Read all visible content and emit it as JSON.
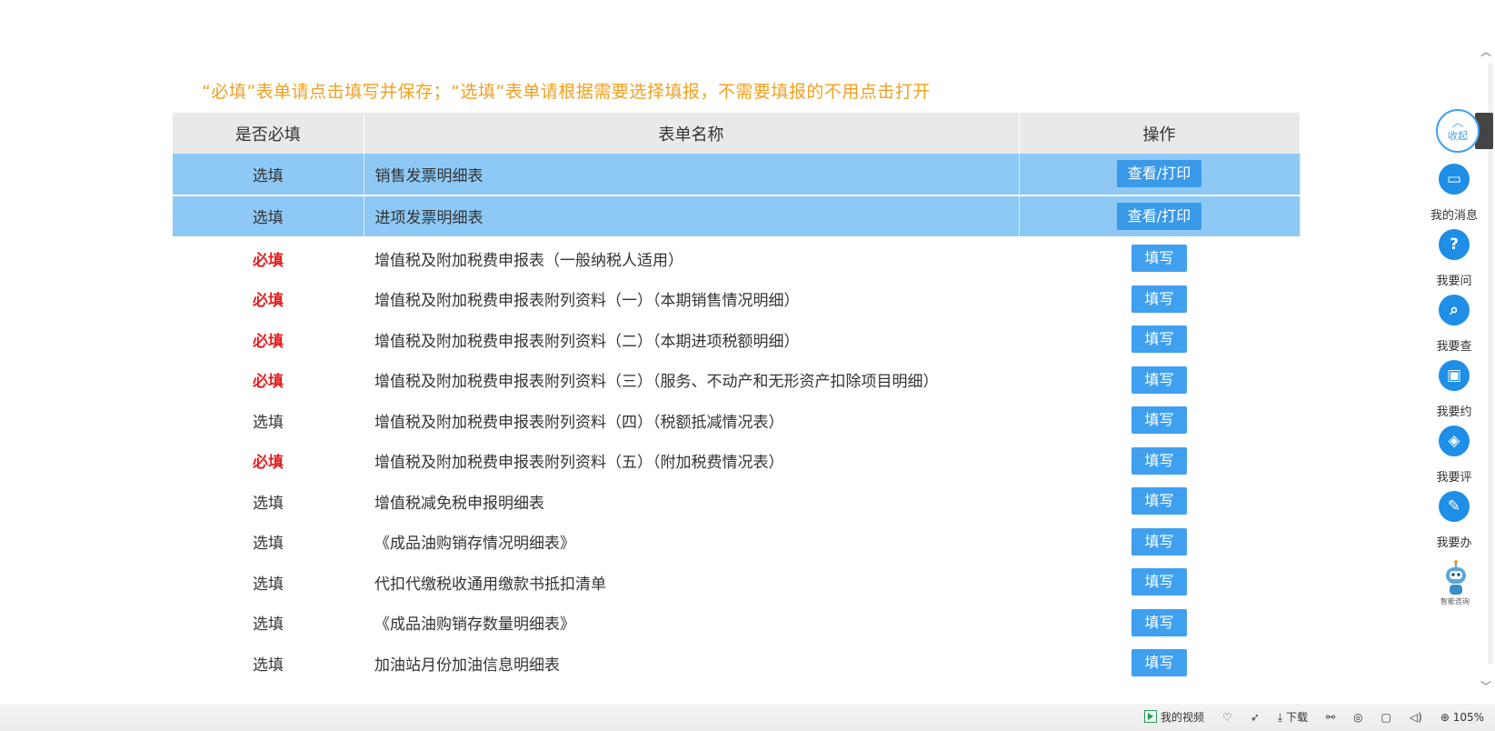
{
  "notice": "“必填”表单请点击填写并保存；“选填”表单请根据需要选择填报，不需要填报的不用点击打开",
  "table": {
    "headers": [
      "是否必填",
      "表单名称",
      "操作"
    ],
    "rows": [
      {
        "req": "选填",
        "name": "销售发票明细表",
        "op": "查看/打印",
        "highlight": true,
        "required": false
      },
      {
        "req": "选填",
        "name": "进项发票明细表",
        "op": "查看/打印",
        "highlight": true,
        "required": false
      },
      {
        "req": "必填",
        "name": "增值税及附加税费申报表（一般纳税人适用）",
        "op": "填写",
        "highlight": false,
        "required": true
      },
      {
        "req": "必填",
        "name": "增值税及附加税费申报表附列资料（一）（本期销售情况明细）",
        "op": "填写",
        "highlight": false,
        "required": true
      },
      {
        "req": "必填",
        "name": "增值税及附加税费申报表附列资料（二）（本期进项税额明细）",
        "op": "填写",
        "highlight": false,
        "required": true
      },
      {
        "req": "必填",
        "name": "增值税及附加税费申报表附列资料（三）（服务、不动产和无形资产扣除项目明细）",
        "op": "填写",
        "highlight": false,
        "required": true
      },
      {
        "req": "选填",
        "name": "增值税及附加税费申报表附列资料（四）（税额抵减情况表）",
        "op": "填写",
        "highlight": false,
        "required": false
      },
      {
        "req": "必填",
        "name": "增值税及附加税费申报表附列资料（五）（附加税费情况表）",
        "op": "填写",
        "highlight": false,
        "required": true
      },
      {
        "req": "选填",
        "name": "增值税减免税申报明细表",
        "op": "填写",
        "highlight": false,
        "required": false
      },
      {
        "req": "选填",
        "name": "《成品油购销存情况明细表》",
        "op": "填写",
        "highlight": false,
        "required": false
      },
      {
        "req": "选填",
        "name": "代扣代缴税收通用缴款书抵扣清单",
        "op": "填写",
        "highlight": false,
        "required": false
      },
      {
        "req": "选填",
        "name": "《成品油购销存数量明细表》",
        "op": "填写",
        "highlight": false,
        "required": false
      },
      {
        "req": "选填",
        "name": "加油站月份加油信息明细表",
        "op": "填写",
        "highlight": false,
        "required": false
      }
    ]
  },
  "side_panel": {
    "collapse": "收起",
    "items": [
      {
        "label": "我的消息",
        "icon": "message-icon"
      },
      {
        "label": "我要问",
        "icon": "question-icon"
      },
      {
        "label": "我要查",
        "icon": "search-icon"
      },
      {
        "label": "我要约",
        "icon": "calendar-icon"
      },
      {
        "label": "我要评",
        "icon": "rate-icon"
      },
      {
        "label": "我要办",
        "icon": "edit-icon"
      }
    ],
    "robot_label": "智能咨询"
  },
  "statusbar": {
    "video": "我的视频",
    "download": "下载",
    "zoom": "105%"
  },
  "colors": {
    "required": "#e02020",
    "notice": "#f0a020",
    "highlight_row": "#8ec9f5",
    "button": "#3fa0f0"
  }
}
